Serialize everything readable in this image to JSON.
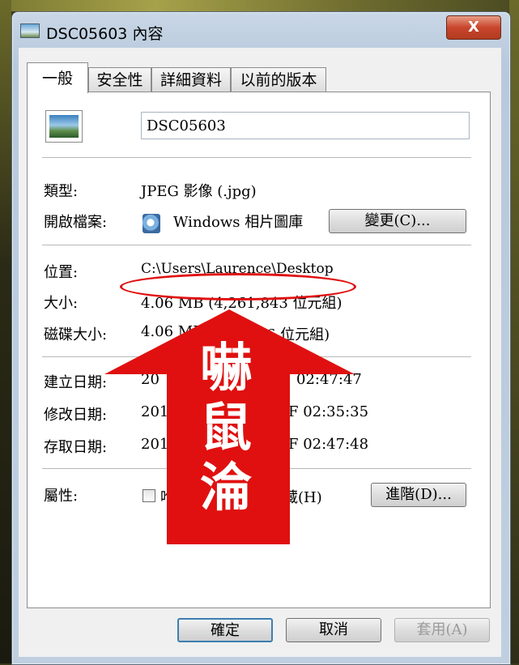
{
  "window": {
    "title": "DSC05603 內容",
    "close_label": "X"
  },
  "tabs": [
    {
      "label": "一般",
      "active": true
    },
    {
      "label": "安全性",
      "active": false
    },
    {
      "label": "詳細資料",
      "active": false
    },
    {
      "label": "以前的版本",
      "active": false
    }
  ],
  "general": {
    "file_name": "DSC05603",
    "type_label": "類型:",
    "type_value": "JPEG 影像 (.jpg)",
    "opens_with_label": "開啟檔案:",
    "opens_with_value": "Windows 相片圖庫",
    "change_button": "變更(C)...",
    "location_label": "位置:",
    "location_value": "C:\\Users\\Laurence\\Desktop",
    "size_label": "大小:",
    "size_value": "4.06 MB (4,261,843 位元組)",
    "size_on_disk_label": "磁碟大小:",
    "size_on_disk_value_a": "4.06 MB (4,",
    "size_on_disk_value_b": "263,936 位元組)",
    "created_label": "建立日期:",
    "created_value_a": "20",
    "created_value_b": "02:47:47",
    "modified_label": "修改日期:",
    "modified_value_a": "201",
    "modified_value_b": "F 02:35:35",
    "accessed_label": "存取日期:",
    "accessed_value_a": "201",
    "accessed_value_b": "F 02:47:48",
    "attributes_label": "屬性:",
    "readonly_partial": "唯",
    "hidden_partial": "藏(H)",
    "advanced_button": "進階(D)..."
  },
  "footer": {
    "ok": "確定",
    "cancel": "取消",
    "apply": "套用(A)"
  },
  "overlay": {
    "chars": [
      "嚇",
      "鼠",
      "淪"
    ],
    "arrow_color": "#e01010",
    "oval_color": "#e01010"
  }
}
